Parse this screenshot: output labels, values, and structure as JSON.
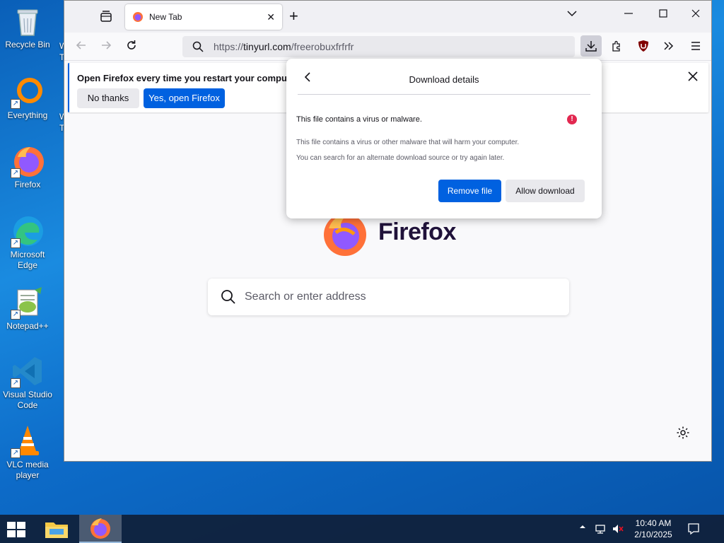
{
  "desktop": {
    "icons": [
      {
        "label": "Recycle Bin"
      },
      {
        "label": "Everything"
      },
      {
        "label": "Firefox"
      },
      {
        "label": "Microsoft Edge"
      },
      {
        "label": "Notepad++"
      },
      {
        "label": "Visual Studio Code"
      },
      {
        "label": "VLC media player"
      }
    ],
    "peek_texts": [
      "W",
      "T",
      "W",
      "T"
    ]
  },
  "browser": {
    "tab": {
      "title": "New Tab"
    },
    "url": {
      "protocol": "https://",
      "host": "tinyurl.com",
      "path": "/freerobuxfrfrfr"
    },
    "notification": {
      "message": "Open Firefox every time you restart your computer?",
      "decline_label": "No thanks",
      "accept_label": "Yes, open Firefox"
    },
    "newtab": {
      "brand": "Firefox",
      "search_placeholder": "Search or enter address"
    },
    "download_panel": {
      "header": "Download details",
      "warning_title": "This file contains a virus or malware.",
      "description_1": "This file contains a virus or other malware that will harm your computer.",
      "description_2": "You can search for an alternate download source or try again later.",
      "remove_label": "Remove file",
      "allow_label": "Allow download"
    }
  },
  "taskbar": {
    "time": "10:40 AM",
    "date": "2/10/2025"
  },
  "colors": {
    "accent": "#0061e0",
    "warning": "#e22850",
    "firefox_orange": "#ff7139",
    "firefox_purple": "#9059ff"
  }
}
